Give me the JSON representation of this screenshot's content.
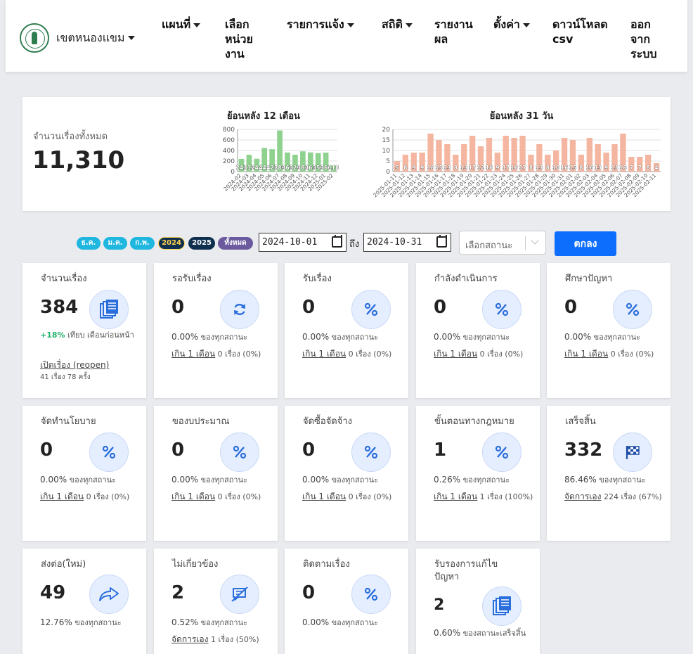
{
  "navbar": {
    "brand": "เขตหนองแขม",
    "items": [
      "แผนที่",
      "เลือกหน่วยงาน",
      "รายการแจ้ง",
      "สถิติ",
      "รายงานผล",
      "ตั้งค่า",
      "ดาวน์โหลด csv",
      "ออกจากระบบ"
    ]
  },
  "summary": {
    "label": "จำนวนเรื่องทั้งหมด",
    "value": "11,310"
  },
  "chart_data": [
    {
      "type": "bar",
      "title": "ย้อนหลัง 12 เดือน",
      "categories": [
        "2024-02",
        "2024-03",
        "2024-04",
        "2024-05",
        "2024-06",
        "2024-07",
        "2024-08",
        "2024-09",
        "2024-10",
        "2024-11",
        "2024-12",
        "2025-01",
        "2025-02"
      ],
      "values": [
        241,
        319,
        244,
        448,
        425,
        780,
        362,
        320,
        384,
        363,
        350,
        360,
        118
      ],
      "ylim": [
        0,
        800
      ],
      "yticks": [
        0,
        200,
        400,
        600,
        800
      ],
      "grid": true,
      "color": "#8fd18f"
    },
    {
      "type": "bar",
      "title": "ย้อนหลัง 31 วัน",
      "categories": [
        "2025-01-11",
        "2025-01-12",
        "2025-01-13",
        "2025-01-14",
        "2025-01-15",
        "2025-01-16",
        "2025-01-17",
        "2025-01-18",
        "2025-01-19",
        "2025-01-20",
        "2025-01-21",
        "2025-01-22",
        "2025-01-23",
        "2025-01-24",
        "2025-01-25",
        "2025-01-26",
        "2025-01-27",
        "2025-01-28",
        "2025-01-29",
        "2025-01-30",
        "2025-01-31",
        "2025-02-01",
        "2025-02-02",
        "2025-02-03",
        "2025-02-04",
        "2025-02-05",
        "2025-02-06",
        "2025-02-07",
        "2025-02-08",
        "2025-02-09",
        "2025-02-10",
        "2025-02-11"
      ],
      "values": [
        5,
        8,
        9,
        9,
        18,
        15,
        13,
        8,
        13,
        17,
        12,
        16,
        9,
        17,
        16,
        17,
        8,
        13,
        8,
        10,
        16,
        15,
        8,
        16,
        13,
        9,
        13,
        18,
        7,
        7,
        8,
        4
      ],
      "ylim": [
        0,
        20
      ],
      "yticks": [
        0,
        5,
        10,
        15,
        20
      ],
      "grid": true,
      "color": "#f4b6a0"
    }
  ],
  "filters": {
    "pills": [
      {
        "label": "ธ.ค.",
        "color": "#1fb7df"
      },
      {
        "label": "ม.ค.",
        "color": "#1fb7df"
      },
      {
        "label": "ก.พ.",
        "color": "#1fb7df"
      },
      {
        "label": "2024",
        "color": "#0f2f4f",
        "text_color": "#ffd34d"
      },
      {
        "label": "2025",
        "color": "#0f2f4f"
      },
      {
        "label": "ทั้งหมด",
        "color": "#6b5a9e"
      }
    ],
    "date_from": "2024-10-01",
    "to_label": "ถึง",
    "date_to": "2024-10-31",
    "status_placeholder": "เลือกสถานะ",
    "submit_label": "ตกลง"
  },
  "cards": [
    {
      "title": "จำนวนเรื่อง",
      "value": "384",
      "icon": "documents-icon",
      "change": "+18%",
      "change_text": "เทียบ เดือนก่อนหน้า",
      "link": "เปิดเรื่อง (reopen)",
      "link_text": "",
      "sub": "41 เรื่อง 78 ครั้ง"
    },
    {
      "title": "รอรับเรื่อง",
      "value": "0",
      "icon": "refresh-icon",
      "pct": "0.00%",
      "pct_text": "ของทุกสถานะ",
      "link": "เกิน 1 เดือน",
      "link_text": "0 เรื่อง (0%)"
    },
    {
      "title": "รับเรื่อง",
      "value": "0",
      "icon": "percent-icon",
      "pct": "0.00%",
      "pct_text": "ของทุกสถานะ",
      "link": "เกิน 1 เดือน",
      "link_text": "0 เรื่อง (0%)"
    },
    {
      "title": "กำลังดำเนินการ",
      "value": "0",
      "icon": "percent-icon",
      "pct": "0.00%",
      "pct_text": "ของทุกสถานะ",
      "link": "เกิน 1 เดือน",
      "link_text": "0 เรื่อง (0%)"
    },
    {
      "title": "ศึกษาปัญหา",
      "value": "0",
      "icon": "percent-icon",
      "pct": "0.00%",
      "pct_text": "ของทุกสถานะ",
      "link": "เกิน 1 เดือน",
      "link_text": "0 เรื่อง (0%)"
    },
    {
      "title": "จัดทำนโยบาย",
      "value": "0",
      "icon": "percent-icon",
      "pct": "0.00%",
      "pct_text": "ของทุกสถานะ",
      "link": "เกิน 1 เดือน",
      "link_text": "0 เรื่อง (0%)"
    },
    {
      "title": "ของบประมาณ",
      "value": "0",
      "icon": "percent-icon",
      "pct": "0.00%",
      "pct_text": "ของทุกสถานะ",
      "link": "เกิน 1 เดือน",
      "link_text": "0 เรื่อง (0%)"
    },
    {
      "title": "จัดซื้อจัดจ้าง",
      "value": "0",
      "icon": "percent-icon",
      "pct": "0.00%",
      "pct_text": "ของทุกสถานะ",
      "link": "เกิน 1 เดือน",
      "link_text": "0 เรื่อง (0%)"
    },
    {
      "title": "ขั้นตอนทางกฎหมาย",
      "value": "1",
      "icon": "percent-icon",
      "pct": "0.26%",
      "pct_text": "ของทุกสถานะ",
      "link": "เกิน 1 เดือน",
      "link_text": "1 เรื่อง (100%)"
    },
    {
      "title": "เสร็จสิ้น",
      "value": "332",
      "icon": "checkered-flag-icon",
      "pct": "86.46%",
      "pct_text": "ของทุกสถานะ",
      "link": "จัดการเอง",
      "link_text": "224 เรื่อง (67%)"
    },
    {
      "title": "ส่งต่อ(ใหม่)",
      "value": "49",
      "icon": "forward-icon",
      "pct": "12.76%",
      "pct_text": "ของทุกสถานะ"
    },
    {
      "title": "ไม่เกี่ยวข้อง",
      "value": "2",
      "icon": "comment-slash-icon",
      "pct": "0.52%",
      "pct_text": "ของทุกสถานะ",
      "link": "จัดการเอง",
      "link_text": "1 เรื่อง (50%)"
    },
    {
      "title": "ติดตามเรื่อง",
      "value": "0",
      "icon": "percent-icon",
      "pct": "0.00%",
      "pct_text": "ของทุกสถานะ"
    },
    {
      "title": "รับรองการแก้ไขปัญหา",
      "value": "2",
      "icon": "documents-icon",
      "pct": "0.60%",
      "pct_text": "ของสถานะเสร็จสิ้น"
    }
  ],
  "colors": {
    "primary": "#0d6efd",
    "icon_blue": "#2a6edb",
    "icon_bg": "#e5eeff",
    "green_change": "#21b36b"
  }
}
